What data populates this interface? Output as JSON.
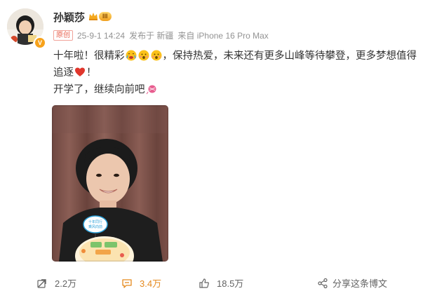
{
  "user": {
    "name": "孙颖莎",
    "vip_level": "III",
    "verified_mark": "V"
  },
  "meta": {
    "original_tag": "原创",
    "datetime": "25-9-1 14:24",
    "location": "发布于 新疆",
    "source": "来自 iPhone 16 Pro Max"
  },
  "post": {
    "line1_part1": "十年啦！很精彩",
    "line1_part2": "，保持热爱，未来还有更多山峰等待攀登，更多梦想值得追逐",
    "line1_part3": "！",
    "line2": "开学了，继续向前吧",
    "photo_text": "十年同行 乘风向前 十年同行 继续加油"
  },
  "actions": {
    "repost_count": "2.2万",
    "comment_count": "3.4万",
    "like_count": "18.5万",
    "share_label": "分享这条博文"
  },
  "colors": {
    "comment_accent": "#e58a1f",
    "original_tag": "#e8624f",
    "meta_text": "#939393"
  }
}
